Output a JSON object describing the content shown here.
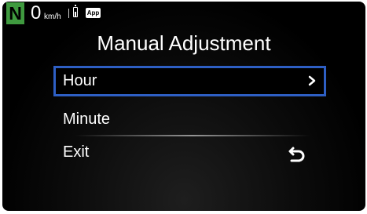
{
  "status": {
    "gear": "N",
    "speed": "0",
    "speed_unit": "km/h",
    "app_badge": "App",
    "gear_color": "#3f9a3f"
  },
  "screen": {
    "title": "Manual Adjustment"
  },
  "menu": {
    "items": [
      {
        "label": "Hour",
        "selected": true,
        "icon": "chevron-right-icon"
      },
      {
        "label": "Minute",
        "selected": false
      },
      {
        "label": "Exit",
        "selected": false,
        "icon": "return-arrow-icon"
      }
    ],
    "highlight_color": "#2e5fc4"
  }
}
